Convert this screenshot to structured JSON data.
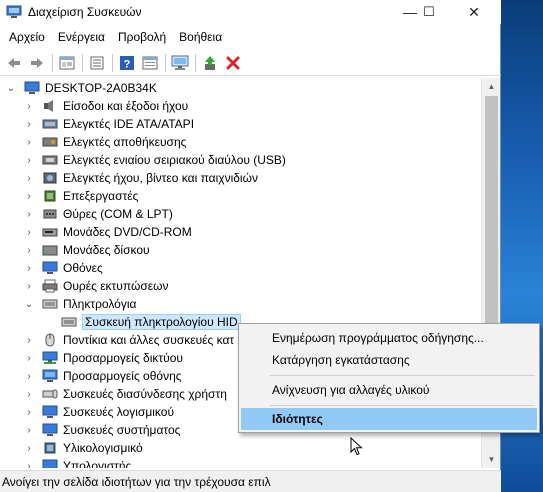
{
  "window": {
    "title": "Διαχείριση Συσκευών",
    "minimize_glyph": "—",
    "maximize_glyph": "☐",
    "close_glyph": "✕"
  },
  "menu": {
    "items": [
      "Αρχείο",
      "Ενέργεια",
      "Προβολή",
      "Βοήθεια"
    ]
  },
  "toolbar": {
    "icons": [
      "back-arrow-icon",
      "forward-arrow-icon",
      "properties-window-icon",
      "update-list-icon",
      "help-icon",
      "view-properties-icon",
      "scan-hardware-icon",
      "update-driver-icon",
      "uninstall-icon"
    ]
  },
  "tree": {
    "root": "DESKTOP-2A0B34K",
    "nodes": [
      {
        "label": "Είσοδοι και έξοδοι ήχου",
        "icon": "audio-icon",
        "expanded": false
      },
      {
        "label": "Ελεγκτές IDE ATA/ATAPI",
        "icon": "ide-controller-icon",
        "expanded": false
      },
      {
        "label": "Ελεγκτές αποθήκευσης",
        "icon": "storage-controller-icon",
        "expanded": false
      },
      {
        "label": "Ελεγκτές ενιαίου σειριακού διαύλου (USB)",
        "icon": "usb-controller-icon",
        "expanded": false
      },
      {
        "label": "Ελεγκτές ήχου, βίντεο και παιχνιδιών",
        "icon": "sound-video-icon",
        "expanded": false
      },
      {
        "label": "Επεξεργαστές",
        "icon": "processor-icon",
        "expanded": false
      },
      {
        "label": "Θύρες (COM & LPT)",
        "icon": "port-icon",
        "expanded": false
      },
      {
        "label": "Μονάδες DVD/CD-ROM",
        "icon": "dvd-drive-icon",
        "expanded": false
      },
      {
        "label": "Μονάδες δίσκου",
        "icon": "disk-drive-icon",
        "expanded": false
      },
      {
        "label": "Οθόνες",
        "icon": "monitor-icon",
        "expanded": false
      },
      {
        "label": "Ουρές εκτυπώσεων",
        "icon": "print-queue-icon",
        "expanded": false
      },
      {
        "label": "Πληκτρολόγια",
        "icon": "keyboard-icon",
        "expanded": true
      },
      {
        "label": "Συσκευή πληκτρολογίου HID",
        "icon": "keyboard-device-icon",
        "child": true,
        "selected": true
      },
      {
        "label": "Ποντίκια και άλλες συσκευές κατ",
        "icon": "mouse-icon",
        "expanded": false
      },
      {
        "label": "Προσαρμογείς δικτύου",
        "icon": "network-adapter-icon",
        "expanded": false
      },
      {
        "label": "Προσαρμογείς οθόνης",
        "icon": "display-adapter-icon",
        "expanded": false
      },
      {
        "label": "Συσκευές διασύνδεσης χρήστη",
        "icon": "hid-icon",
        "expanded": false
      },
      {
        "label": "Συσκευές λογισμικού",
        "icon": "software-device-icon",
        "expanded": false
      },
      {
        "label": "Συσκευές συστήματος",
        "icon": "system-device-icon",
        "expanded": false
      },
      {
        "label": "Υλικολογισμικό",
        "icon": "firmware-icon",
        "expanded": false
      },
      {
        "label": "Υπολογιστής",
        "icon": "computer-icon",
        "expanded": false
      }
    ]
  },
  "context_menu": {
    "items": [
      {
        "label": "Ενημέρωση προγράμματος οδήγησης...",
        "bold": false,
        "highlight": false
      },
      {
        "label": "Κατάργηση εγκατάστασης",
        "bold": false,
        "highlight": false
      },
      {
        "label": "Ανίχνευση για αλλαγές υλικού",
        "bold": false,
        "highlight": false
      },
      {
        "label": "Ιδιότητες",
        "bold": true,
        "highlight": true
      }
    ]
  },
  "status": {
    "text": "Ανοίγει την σελίδα ιδιοτήτων για την τρέχουσα επιλ"
  },
  "colors": {
    "selection": "#cce8ff",
    "menu_highlight": "#91c9f7",
    "uninstall_red": "#d9242b",
    "help_blue": "#2b5cb8"
  }
}
